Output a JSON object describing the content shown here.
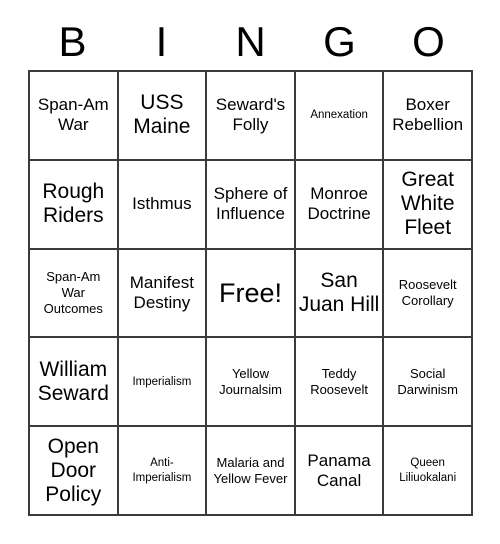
{
  "card": {
    "title": "BINGO",
    "header_letters": [
      "B",
      "I",
      "N",
      "G",
      "O"
    ],
    "free_space_label": "Free!",
    "rows": [
      [
        {
          "label": "Span-Am War",
          "size": "md"
        },
        {
          "label": "USS Maine",
          "size": "lg"
        },
        {
          "label": "Seward's Folly",
          "size": "md"
        },
        {
          "label": "Annexation",
          "size": "xs"
        },
        {
          "label": "Boxer Rebellion",
          "size": "md"
        }
      ],
      [
        {
          "label": "Rough Riders",
          "size": "lg"
        },
        {
          "label": "Isthmus",
          "size": "md"
        },
        {
          "label": "Sphere of Influence",
          "size": "md"
        },
        {
          "label": "Monroe Doctrine",
          "size": "md"
        },
        {
          "label": "Great White Fleet",
          "size": "lg"
        }
      ],
      [
        {
          "label": "Span-Am War Outcomes",
          "size": "sm"
        },
        {
          "label": "Manifest Destiny",
          "size": "md"
        },
        {
          "label": "Free!",
          "size": "xl"
        },
        {
          "label": "San Juan Hill",
          "size": "lg"
        },
        {
          "label": "Roosevelt Corollary",
          "size": "sm"
        }
      ],
      [
        {
          "label": "William Seward",
          "size": "lg"
        },
        {
          "label": "Imperialism",
          "size": "xs"
        },
        {
          "label": "Yellow Journalsim",
          "size": "sm"
        },
        {
          "label": "Teddy Roosevelt",
          "size": "sm"
        },
        {
          "label": "Social Darwinism",
          "size": "sm"
        }
      ],
      [
        {
          "label": "Open Door Policy",
          "size": "lg"
        },
        {
          "label": "Anti-Imperialism",
          "size": "xs"
        },
        {
          "label": "Malaria and Yellow Fever",
          "size": "sm"
        },
        {
          "label": "Panama Canal",
          "size": "md"
        },
        {
          "label": "Queen Liliuokalani",
          "size": "xs"
        }
      ]
    ]
  },
  "colors": {
    "border": "#3b3b3b",
    "text": "#000000",
    "background": "#ffffff"
  }
}
